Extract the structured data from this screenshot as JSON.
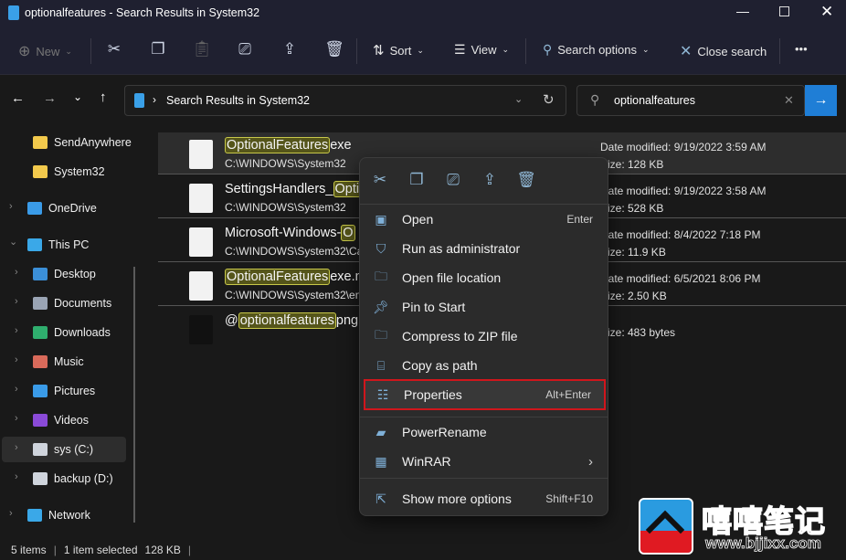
{
  "window": {
    "title": "optionalfeatures - Search Results in System32",
    "controls": [
      "minimize",
      "maximize",
      "close"
    ]
  },
  "toolbar": {
    "new_label": "New",
    "sort_label": "Sort",
    "view_label": "View",
    "search_options_label": "Search options",
    "close_search_label": "Close search",
    "more_label": "•••"
  },
  "nav": {
    "breadcrumb": "Search Results in System32",
    "search_value": "optionalfeatures"
  },
  "sidebar": {
    "items": [
      {
        "label": "SendAnywhere",
        "icon": "folder-icon"
      },
      {
        "label": "System32",
        "icon": "folder-icon"
      },
      {
        "label": "OneDrive",
        "icon": "cloud-icon"
      },
      {
        "label": "This PC",
        "icon": "computer-icon"
      },
      {
        "label": "Desktop",
        "icon": "desktop-icon"
      },
      {
        "label": "Documents",
        "icon": "documents-icon"
      },
      {
        "label": "Downloads",
        "icon": "download-icon"
      },
      {
        "label": "Music",
        "icon": "music-icon"
      },
      {
        "label": "Pictures",
        "icon": "pictures-icon"
      },
      {
        "label": "Videos",
        "icon": "videos-icon"
      },
      {
        "label": "sys (C:)",
        "icon": "drive-icon"
      },
      {
        "label": "backup (D:)",
        "icon": "drive-icon"
      },
      {
        "label": "Network",
        "icon": "network-icon"
      }
    ]
  },
  "files": [
    {
      "pre": "",
      "hl": "OptionalFeatures",
      "post": "exe",
      "path": "C:\\WINDOWS\\System32",
      "date": "Date modified: 9/19/2022 3:59 AM",
      "size": "Size: 128 KB"
    },
    {
      "pre": "SettingsHandlers_",
      "hl": "Opti",
      "post": "",
      "path": "C:\\WINDOWS\\System32",
      "date": "Date modified: 9/19/2022 3:58 AM",
      "size": "Size: 528 KB"
    },
    {
      "pre": "Microsoft-Windows-",
      "hl": "O",
      "post": "",
      "path": "C:\\WINDOWS\\System32\\Ca",
      "date": "Date modified: 8/4/2022 7:18 PM",
      "size": "Size: 11.9 KB"
    },
    {
      "pre": "",
      "hl": "OptionalFeatures",
      "post": "exe.m",
      "path": "C:\\WINDOWS\\System32\\en",
      "date": "Date modified: 6/5/2021 8:06 PM",
      "size": "Size: 2.50 KB"
    },
    {
      "pre": "@",
      "hl": "optionalfeatures",
      "post": "png",
      "path": "",
      "date": "",
      "size": "Size: 483 bytes"
    }
  ],
  "context_menu": {
    "items": [
      {
        "label": "Open",
        "shortcut": "Enter",
        "icon": "open-icon"
      },
      {
        "label": "Run as administrator",
        "shortcut": "",
        "icon": "shield-icon"
      },
      {
        "label": "Open file location",
        "shortcut": "",
        "icon": "folder-icon"
      },
      {
        "label": "Pin to Start",
        "shortcut": "",
        "icon": "pin-icon"
      },
      {
        "label": "Compress to ZIP file",
        "shortcut": "",
        "icon": "zip-icon"
      },
      {
        "label": "Copy as path",
        "shortcut": "",
        "icon": "path-icon"
      },
      {
        "label": "Properties",
        "shortcut": "Alt+Enter",
        "icon": "properties-icon"
      },
      {
        "label": "PowerRename",
        "shortcut": "",
        "icon": "powerrename-icon"
      },
      {
        "label": "WinRAR",
        "shortcut": "",
        "icon": "winrar-icon"
      },
      {
        "label": "Show more options",
        "shortcut": "Shift+F10",
        "icon": "more-options-icon"
      }
    ],
    "highlighted": "Properties",
    "highlight_color": "#d0161c"
  },
  "status": {
    "count": "5 items",
    "selected": "1 item selected",
    "size": "128 KB"
  },
  "watermark": {
    "title": "嘻嘻笔记",
    "url": "www.bjjixx.com"
  }
}
